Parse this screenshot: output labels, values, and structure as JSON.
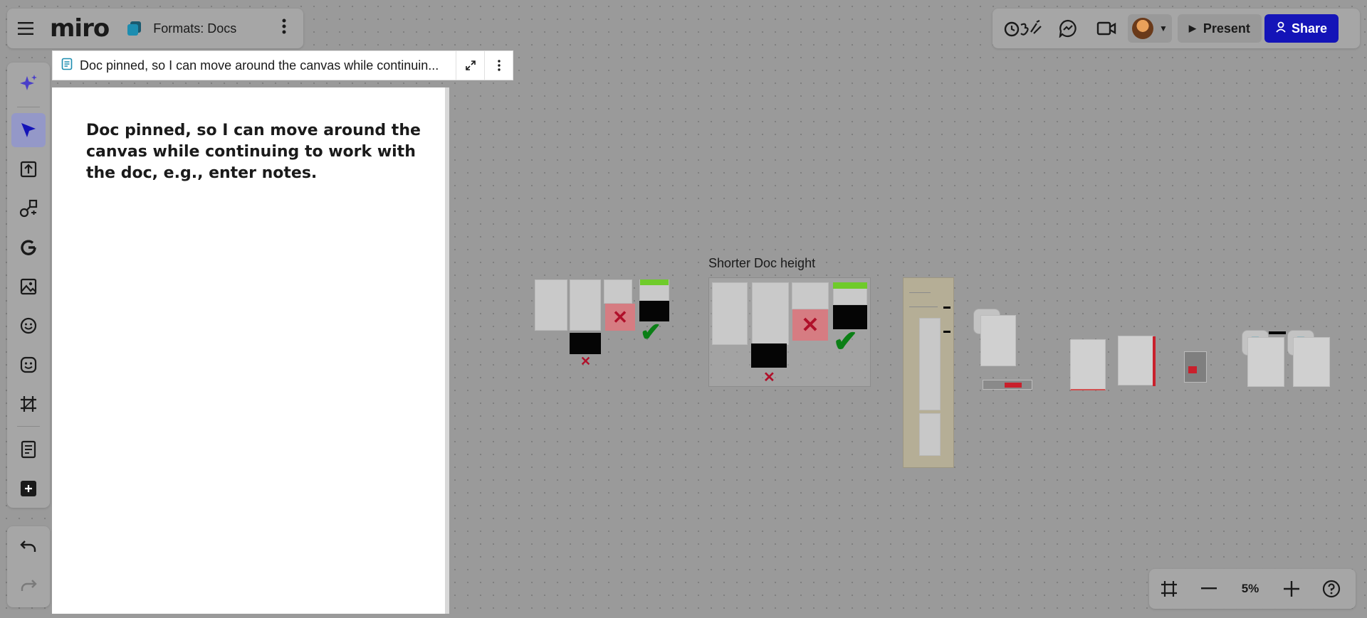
{
  "board": {
    "logo": "miro",
    "title": "Formats: Docs"
  },
  "toolbar_top_right": {
    "present_label": "Present",
    "share_label": "Share"
  },
  "pinned_doc": {
    "header_title": "Doc pinned, so I can move around the canvas while continuin...",
    "body_text": "Doc pinned, so I can move around the canvas while continuing to work with the doc, e.g., enter notes."
  },
  "canvas": {
    "frame_label": "Shorter Doc height"
  },
  "zoom": {
    "level": "5%"
  },
  "colors": {
    "accent": "#1414b8",
    "canvas": "#9a9a9a",
    "doc_icon": "#1c8db0"
  },
  "icons": {
    "left_toolbar": [
      "ai-sparkle-icon",
      "select-icon",
      "upload-icon",
      "shapes-connect-icon",
      "google-icon",
      "image-icon",
      "sticker-icon",
      "emoji-icon",
      "frame-icon",
      "doc-icon",
      "add-icon",
      "undo-icon",
      "redo-icon"
    ],
    "top_right": [
      "timer-reactions-icon",
      "chat-icon",
      "video-icon"
    ]
  }
}
